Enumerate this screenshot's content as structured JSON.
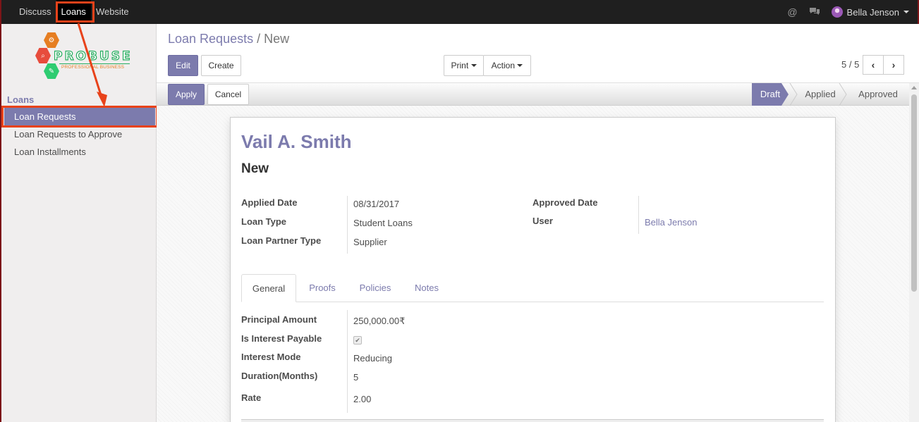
{
  "topbar": {
    "menu": [
      "Discuss",
      "Loans",
      "Website"
    ],
    "active": "Loans",
    "user": "Bella Jenson"
  },
  "sidebar": {
    "brand": "PROBUSE",
    "tagline": "PROFESSIONAL BUSINESS",
    "section": "Loans",
    "items": [
      "Loan Requests",
      "Loan Requests to Approve",
      "Loan Installments"
    ]
  },
  "control": {
    "breadcrumb_link": "Loan Requests",
    "breadcrumb_sep": "/",
    "breadcrumb_current": "New",
    "edit": "Edit",
    "create": "Create",
    "print": "Print",
    "action": "Action",
    "pager": "5 / 5"
  },
  "statusbar": {
    "apply": "Apply",
    "cancel": "Cancel",
    "stages": [
      "Draft",
      "Applied",
      "Approved"
    ],
    "current": "Draft"
  },
  "form": {
    "name": "Vail A. Smith",
    "subtitle": "New",
    "applied_date_label": "Applied Date",
    "applied_date": "08/31/2017",
    "loan_type_label": "Loan Type",
    "loan_type": "Student Loans",
    "partner_type_label": "Loan Partner Type",
    "partner_type": "Supplier",
    "approved_date_label": "Approved Date",
    "approved_date": "",
    "user_label": "User",
    "user": "Bella Jenson"
  },
  "tabs": [
    "General",
    "Proofs",
    "Policies",
    "Notes"
  ],
  "general": {
    "principal_label": "Principal Amount",
    "principal": "250,000.00₹",
    "interest_payable_label": "Is Interest Payable",
    "interest_payable": true,
    "interest_mode_label": "Interest Mode",
    "interest_mode": "Reducing",
    "duration_label": "Duration(Months)",
    "duration": "5",
    "rate_label": "Rate",
    "rate": "2.00"
  },
  "colors": {
    "accent": "#7c7bad",
    "highlight": "#e8421a",
    "topbar": "#1f1f1f"
  },
  "icons": [
    "at-icon",
    "chat-icon",
    "chevron-left-icon",
    "chevron-right-icon"
  ]
}
